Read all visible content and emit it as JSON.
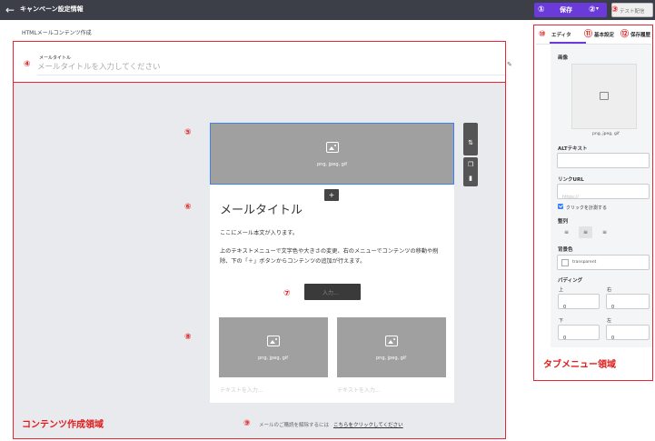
{
  "topbar": {
    "back_icon": "arrow-left-icon",
    "title": "キャンペーン設定情報",
    "save_label": "保存",
    "save_dropdown": "▾",
    "test_label": "テスト配信"
  },
  "markers": [
    "①",
    "②",
    "③",
    "④",
    "⑤",
    "⑥",
    "⑦",
    "⑧",
    "⑨",
    "⑩",
    "⑪",
    "⑫"
  ],
  "editor": {
    "subheader": "HTMLメールコンテンツ作成",
    "mail_title_label": "メールタイトル",
    "mail_title_placeholder": "メールタイトルを入力してください",
    "header_image_caption": "png, jpeg, gif",
    "add_button": "+",
    "email_title": "メールタイトル",
    "body_line1": "ここにメール本文が入ります。",
    "body_line2": "上のテキストメニューで文字色や大きさの変更、右のメニューでコンテンツの移動や削除、下の「＋」ボタンからコンテンツの追加が行えます。",
    "input_button": "入力...",
    "col1_caption": "png, jpeg, gif",
    "col2_caption": "png, jpeg, gif",
    "col1_text": "テキストを入力...",
    "col2_text": "テキストを入力...",
    "unsubscribe_text": "メールのご購読を解除するには",
    "unsubscribe_link": "こちらをクリックしてください",
    "area_label": "コンテンツ作成領域"
  },
  "panel": {
    "tabs": [
      "エディタ",
      "基本設定",
      "保存履歴"
    ],
    "image_label": "画像",
    "image_caption": "png, jpeg, gif",
    "alt_label": "ALTテキスト",
    "link_label": "リンクURL",
    "link_placeholder": "https://",
    "click_measure_label": "クリックを計測する",
    "click_measure_checked": true,
    "align_label": "整列",
    "align_options": [
      "≡",
      "≡",
      "≡"
    ],
    "align_selected": "center",
    "bg_color_label": "背景色",
    "bg_color_value": "transparent",
    "padding_label": "パディング",
    "padding": {
      "top_label": "上",
      "top_value": "0",
      "right_label": "右",
      "right_value": "0",
      "bottom_label": "下",
      "bottom_value": "0",
      "left_label": "左",
      "left_value": "0"
    },
    "area_label": "タブメニュー領域"
  },
  "colors": {
    "accent": "#6a3bd8",
    "annotation": "#e01b1b",
    "topbar": "#3c3f47",
    "image_placeholder": "#a0a0a0"
  }
}
